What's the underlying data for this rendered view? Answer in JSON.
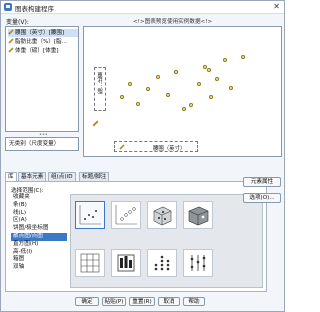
{
  "window": {
    "title": "图表构建程序",
    "close_glyph": "✕"
  },
  "variables": {
    "label": "变量(V):",
    "items": [
      {
        "label": "腰围（英寸）[腰围]",
        "selected": true
      },
      {
        "label": "脂肪比重（%）[脂...",
        "selected": false
      },
      {
        "label": "体重（磅）[体重]",
        "selected": false
      }
    ],
    "splitter": "•••"
  },
  "conditions": {
    "text": "无类别（尺度变量）"
  },
  "canvas": {
    "hint": "<!>图表预览使用实例数据<!>",
    "y_drop": "脂…比重",
    "x_drop": "腰围（英寸）",
    "points_color": "#8a7a12",
    "points": [
      {
        "x": 0.18,
        "y": 0.52
      },
      {
        "x": 0.22,
        "y": 0.42
      },
      {
        "x": 0.26,
        "y": 0.57
      },
      {
        "x": 0.31,
        "y": 0.46
      },
      {
        "x": 0.36,
        "y": 0.37
      },
      {
        "x": 0.41,
        "y": 0.5
      },
      {
        "x": 0.45,
        "y": 0.33
      },
      {
        "x": 0.49,
        "y": 0.61
      },
      {
        "x": 0.53,
        "y": 0.58
      },
      {
        "x": 0.57,
        "y": 0.42
      },
      {
        "x": 0.6,
        "y": 0.29
      },
      {
        "x": 0.62,
        "y": 0.31
      },
      {
        "x": 0.66,
        "y": 0.38
      },
      {
        "x": 0.7,
        "y": 0.24
      },
      {
        "x": 0.63,
        "y": 0.52
      },
      {
        "x": 0.73,
        "y": 0.45
      },
      {
        "x": 0.79,
        "y": 0.21
      }
    ]
  },
  "tabs": [
    {
      "label": "库",
      "active": true
    },
    {
      "label": "基本元素",
      "active": false
    },
    {
      "label": "组(点)ID",
      "active": false
    },
    {
      "label": "标题/脚注",
      "active": false
    }
  ],
  "gallery": {
    "label": "选择范围(C):",
    "categories": [
      {
        "label": "收藏夹",
        "selected": false
      },
      {
        "label": "条(B)",
        "selected": false
      },
      {
        "label": "线(L)",
        "selected": false
      },
      {
        "label": "区(A)",
        "selected": false
      },
      {
        "label": "饼图/极坐标图",
        "selected": false
      },
      {
        "label": "散点图/点图",
        "selected": true
      },
      {
        "label": "直方图(H)",
        "selected": false
      },
      {
        "label": "高-低(I)",
        "selected": false
      },
      {
        "label": "箱图",
        "selected": false
      },
      {
        "label": "双轴",
        "selected": false
      }
    ],
    "thumbnails": [
      {
        "name": "simple-scatter",
        "selected": true
      },
      {
        "name": "grouped-scatter",
        "selected": false
      },
      {
        "name": "3d-scatter",
        "selected": false
      },
      {
        "name": "summary-point",
        "selected": false
      },
      {
        "name": "scatter-matrix",
        "selected": false
      },
      {
        "name": "simple-dot",
        "selected": false
      },
      {
        "name": "simple-dot-2",
        "selected": false
      },
      {
        "name": "drop-line",
        "selected": false
      }
    ]
  },
  "side_buttons": {
    "element_properties": "元素属性",
    "options": "选项(O)..."
  },
  "footer": {
    "ok": "确定",
    "paste": "粘贴(P)",
    "reset": "重置(R)",
    "cancel": "取消",
    "help": "帮助"
  },
  "colors": {
    "accent": "#3b78c7",
    "selection": "#cfe0f5"
  }
}
